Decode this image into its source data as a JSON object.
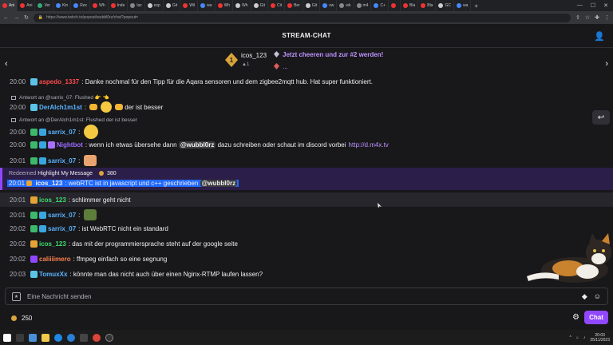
{
  "browser": {
    "tabs": [
      {
        "label": "Ani",
        "color": "#e33"
      },
      {
        "label": "Ani",
        "color": "#e33"
      },
      {
        "label": "Ver",
        "color": "#3a7"
      },
      {
        "label": "Kin",
        "color": "#48f"
      },
      {
        "label": "Rec",
        "color": "#48f"
      },
      {
        "label": "Wh",
        "color": "#e33"
      },
      {
        "label": "Inde",
        "color": "#e33"
      },
      {
        "label": "laz",
        "color": "#888"
      },
      {
        "label": "esp",
        "color": "#ccc"
      },
      {
        "label": "Git",
        "color": "#ccc"
      },
      {
        "label": "Wil",
        "color": "#e33"
      },
      {
        "label": "wa",
        "color": "#48f"
      },
      {
        "label": "Wh",
        "color": "#e33"
      },
      {
        "label": "Wh",
        "color": "#ccc"
      },
      {
        "label": "Git",
        "color": "#ccc"
      },
      {
        "label": "Cit",
        "color": "#e33"
      },
      {
        "label": "Ber",
        "color": "#e33"
      },
      {
        "label": "Git",
        "color": "#ccc"
      },
      {
        "label": "sw",
        "color": "#48f"
      },
      {
        "label": "wk",
        "color": "#888"
      },
      {
        "label": "m4",
        "color": "#888"
      },
      {
        "label": "C+",
        "color": "#48f"
      },
      {
        "label": "",
        "color": "#e33"
      },
      {
        "label": "Bla",
        "color": "#e33"
      },
      {
        "label": "Bla",
        "color": "#e33"
      },
      {
        "label": "GC",
        "color": "#ccc"
      },
      {
        "label": "wa",
        "color": "#48f"
      }
    ],
    "url": "https://www.twitch.tv/popout/wubbl0rz/chat?popout="
  },
  "header": {
    "title": "STREAM-CHAT"
  },
  "leaderboard": {
    "rank": "1",
    "user": "icos_123",
    "count": "1",
    "cheer_text": "Jetzt cheeren und zur #2 werden!",
    "dots": "..."
  },
  "messages": [
    {
      "ts": "20:00",
      "user": "aspedo_1337",
      "color": "#ff4a4a",
      "text": "Danke nochmal für den Tipp für die Aqara sensoren und dem zigbee2mqtt hub. Hat super funktioniert."
    },
    {
      "reply": "Antwort an @sarrix_07: Flushed"
    },
    {
      "ts": "20:00",
      "user": "DerAlch1m1st",
      "color": "#5ab4ff",
      "text": "der ist besser"
    },
    {
      "reply": "Antwort an @DerAlch1m1st: Flushed der ist besser"
    },
    {
      "ts": "20:00",
      "user": "sarrix_07",
      "color": "#5ab4ff",
      "text": ""
    },
    {
      "ts": "20:00",
      "user": "Nightbot",
      "color": "#9b6bff",
      "text": "wenn ich etwas übersehe dann",
      "mention": "@wubbl0rz",
      "text2": "dazu schreiben oder schaut im discord vorbei",
      "link": "http://d.m4x.tv"
    },
    {
      "ts": "20:01",
      "user": "sarrix_07",
      "color": "#5ab4ff",
      "text": ""
    },
    {
      "ts": "20:01",
      "user": "icos_123",
      "color": "#3ede6a",
      "text": "schlimmer geht nicht"
    },
    {
      "ts": "20:01",
      "user": "sarrix_07",
      "color": "#5ab4ff",
      "text": ""
    },
    {
      "ts": "20:02",
      "user": "sarrix_07",
      "color": "#5ab4ff",
      "text": "ist WebRTC nicht ein standard"
    },
    {
      "ts": "20:02",
      "user": "icos_123",
      "color": "#3ede6a",
      "text": "das mit der programmiersprache steht auf der google seite"
    },
    {
      "ts": "20:02",
      "user": "caliiiimero",
      "color": "#ff7f50",
      "text": "ffmpeg einfach so eine segnung"
    },
    {
      "ts": "20:03",
      "user": "TomuxXx",
      "color": "#5ab4ff",
      "text": "könnte man das nicht auch über einen Nginx-RTMP laufen lassen?"
    }
  ],
  "highlight": {
    "redeemed_label": "Redeemed",
    "reward": "Highlight My Message",
    "cost": "380",
    "ts": "20:01",
    "user": "icos_123",
    "text": "webRTC ist in javascript und c++ geschrieben",
    "mention": "@wubbl0rz"
  },
  "input": {
    "placeholder": "Eine Nachricht senden"
  },
  "footer": {
    "points": "250",
    "chat_button": "Chat"
  },
  "taskbar": {
    "time": "20:03",
    "date": "25/11/2023"
  }
}
